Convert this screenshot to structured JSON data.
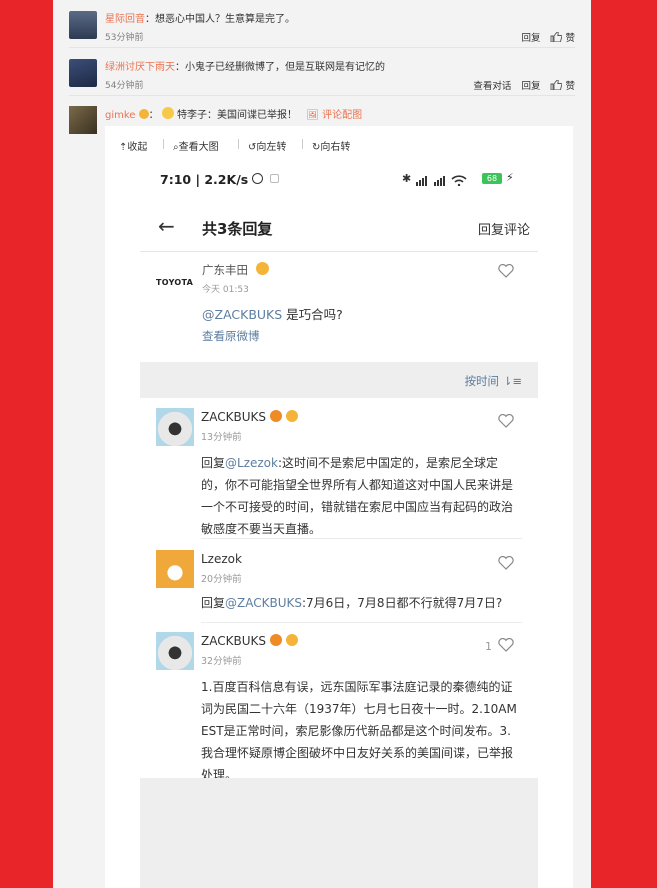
{
  "comments": [
    {
      "user": "星际回音",
      "text": "：想恶心中国人？生意算是完了。",
      "time": "53分钟前",
      "actions": [
        "回复",
        "赞"
      ]
    },
    {
      "user": "绿洲讨厌下雨天",
      "text": "：小鬼子已经删微博了，但是互联网是有记忆的",
      "time": "54分钟前",
      "actions": [
        "查看对话",
        "回复",
        "赞"
      ]
    },
    {
      "user": "gimke",
      "emoji_text": "特李子：美国间谍已举报！",
      "pic_label": "评论配图"
    }
  ],
  "toolbar": {
    "collapse": "收起",
    "view_large": "查看大图",
    "rotate_left": "向左转",
    "rotate_right": "向右转"
  },
  "phone": {
    "status_time": "7:10 | 2.2K/s",
    "battery": "68",
    "nav": {
      "back": "←",
      "title": "共3条回复",
      "reply_comment": "回复评论"
    },
    "original": {
      "user": "广东丰田",
      "logo": "TOYOTA",
      "time": "今天 01:53",
      "mention": "@ZACKBUKS",
      "text": " 是巧合吗?",
      "view_original": "查看原微博"
    },
    "sort_label": "按时间",
    "replies": [
      {
        "user": "ZACKBUKS",
        "time": "13分钟前",
        "prefix": "回复",
        "mention": "@Lzezok",
        "text": ":这时间不是索尼中国定的，是索尼全球定的，你不可能指望全世界所有人都知道这对中国人民来讲是一个不可接受的时间，错就错在索尼中国应当有起码的政治敏感度不要当天直播。"
      },
      {
        "user": "Lzezok",
        "time": "20分钟前",
        "prefix": "回复",
        "mention": "@ZACKBUKS",
        "text": ":7月6日，7月8日都不行就得7月7日?"
      },
      {
        "user": "ZACKBUKS",
        "time": "32分钟前",
        "likes": "1",
        "text": "1.百度百科信息有误，远东国际军事法庭记录的秦德纯的证词为民国二十六年（1937年）七月七日夜十一时。2.10AM EST是正常时间，索尼影像历代新品都是这个时间发布。3.我合理怀疑原博企图破坏中日友好关系的美国间谍，已举报处理。"
      }
    ]
  },
  "colors": {
    "background": "#e8262a",
    "username": "#eb7350",
    "link": "#5e7ea0"
  }
}
